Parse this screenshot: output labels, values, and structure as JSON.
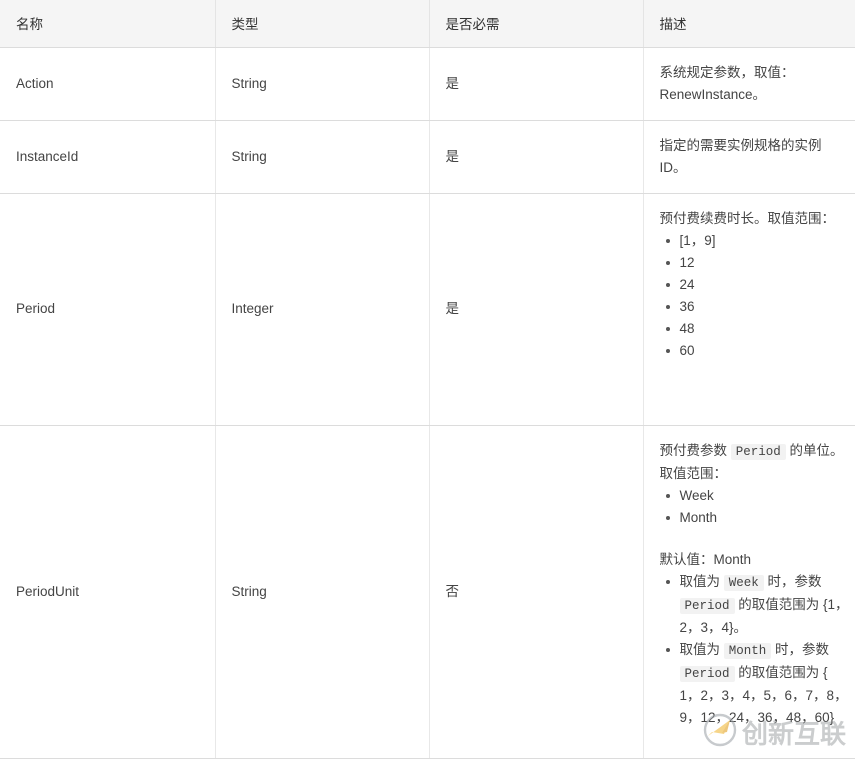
{
  "table": {
    "columns": [
      {
        "key": "name",
        "label": "名称"
      },
      {
        "key": "type",
        "label": "类型"
      },
      {
        "key": "required",
        "label": "是否必需"
      },
      {
        "key": "description",
        "label": "描述"
      }
    ],
    "rows": [
      {
        "name": "Action",
        "type": "String",
        "required": "是",
        "description_text": "系统规定参数，取值：RenewInstance。",
        "desc_lines": [
          "系统规定参数，取值：",
          "RenewInstance。"
        ]
      },
      {
        "name": "InstanceId",
        "type": "String",
        "required": "是",
        "description_text": "指定的需要实例规格的实例ID。",
        "desc_lines": [
          "指定的需要实例规格的实例",
          "ID。"
        ]
      },
      {
        "name": "Period",
        "type": "Integer",
        "required": "是",
        "description_intro": "预付费续费时长。取值范围：",
        "description_items": [
          "[1，9]",
          "12",
          "24",
          "36",
          "48",
          "60"
        ]
      },
      {
        "name": "PeriodUnit",
        "type": "String",
        "required": "否",
        "description_intro_prefix": "预付费参数 ",
        "description_intro_code": "Period",
        "description_intro_suffix": " 的单位。取值范围：",
        "description_items": [
          "Week",
          "Month"
        ],
        "default_line": "默认值：Month",
        "nested_items": [
          {
            "prefix": "取值为 ",
            "code1": "Week",
            "middle": " 时，参数 ",
            "code2": "Period",
            "suffix": " 的取值范围为 {1，2，3，4}。"
          },
          {
            "prefix": "取值为 ",
            "code1": "Month",
            "middle": " 时，参数 ",
            "code2": "Period",
            "suffix": " 的取值范围为 { 1，2，3，4，5，6，7，8，9，12，24，36，48，60}"
          }
        ]
      }
    ]
  },
  "watermark": {
    "text": "创新互联",
    "logo_name": "swoosh-logo",
    "logo_color": "#f0b429",
    "ring_color": "#9aa0a6"
  },
  "colors": {
    "header_background": "#f5f5f5",
    "border": "#dcdcdc",
    "text": "#444444",
    "code_background": "#f2f2f2"
  }
}
